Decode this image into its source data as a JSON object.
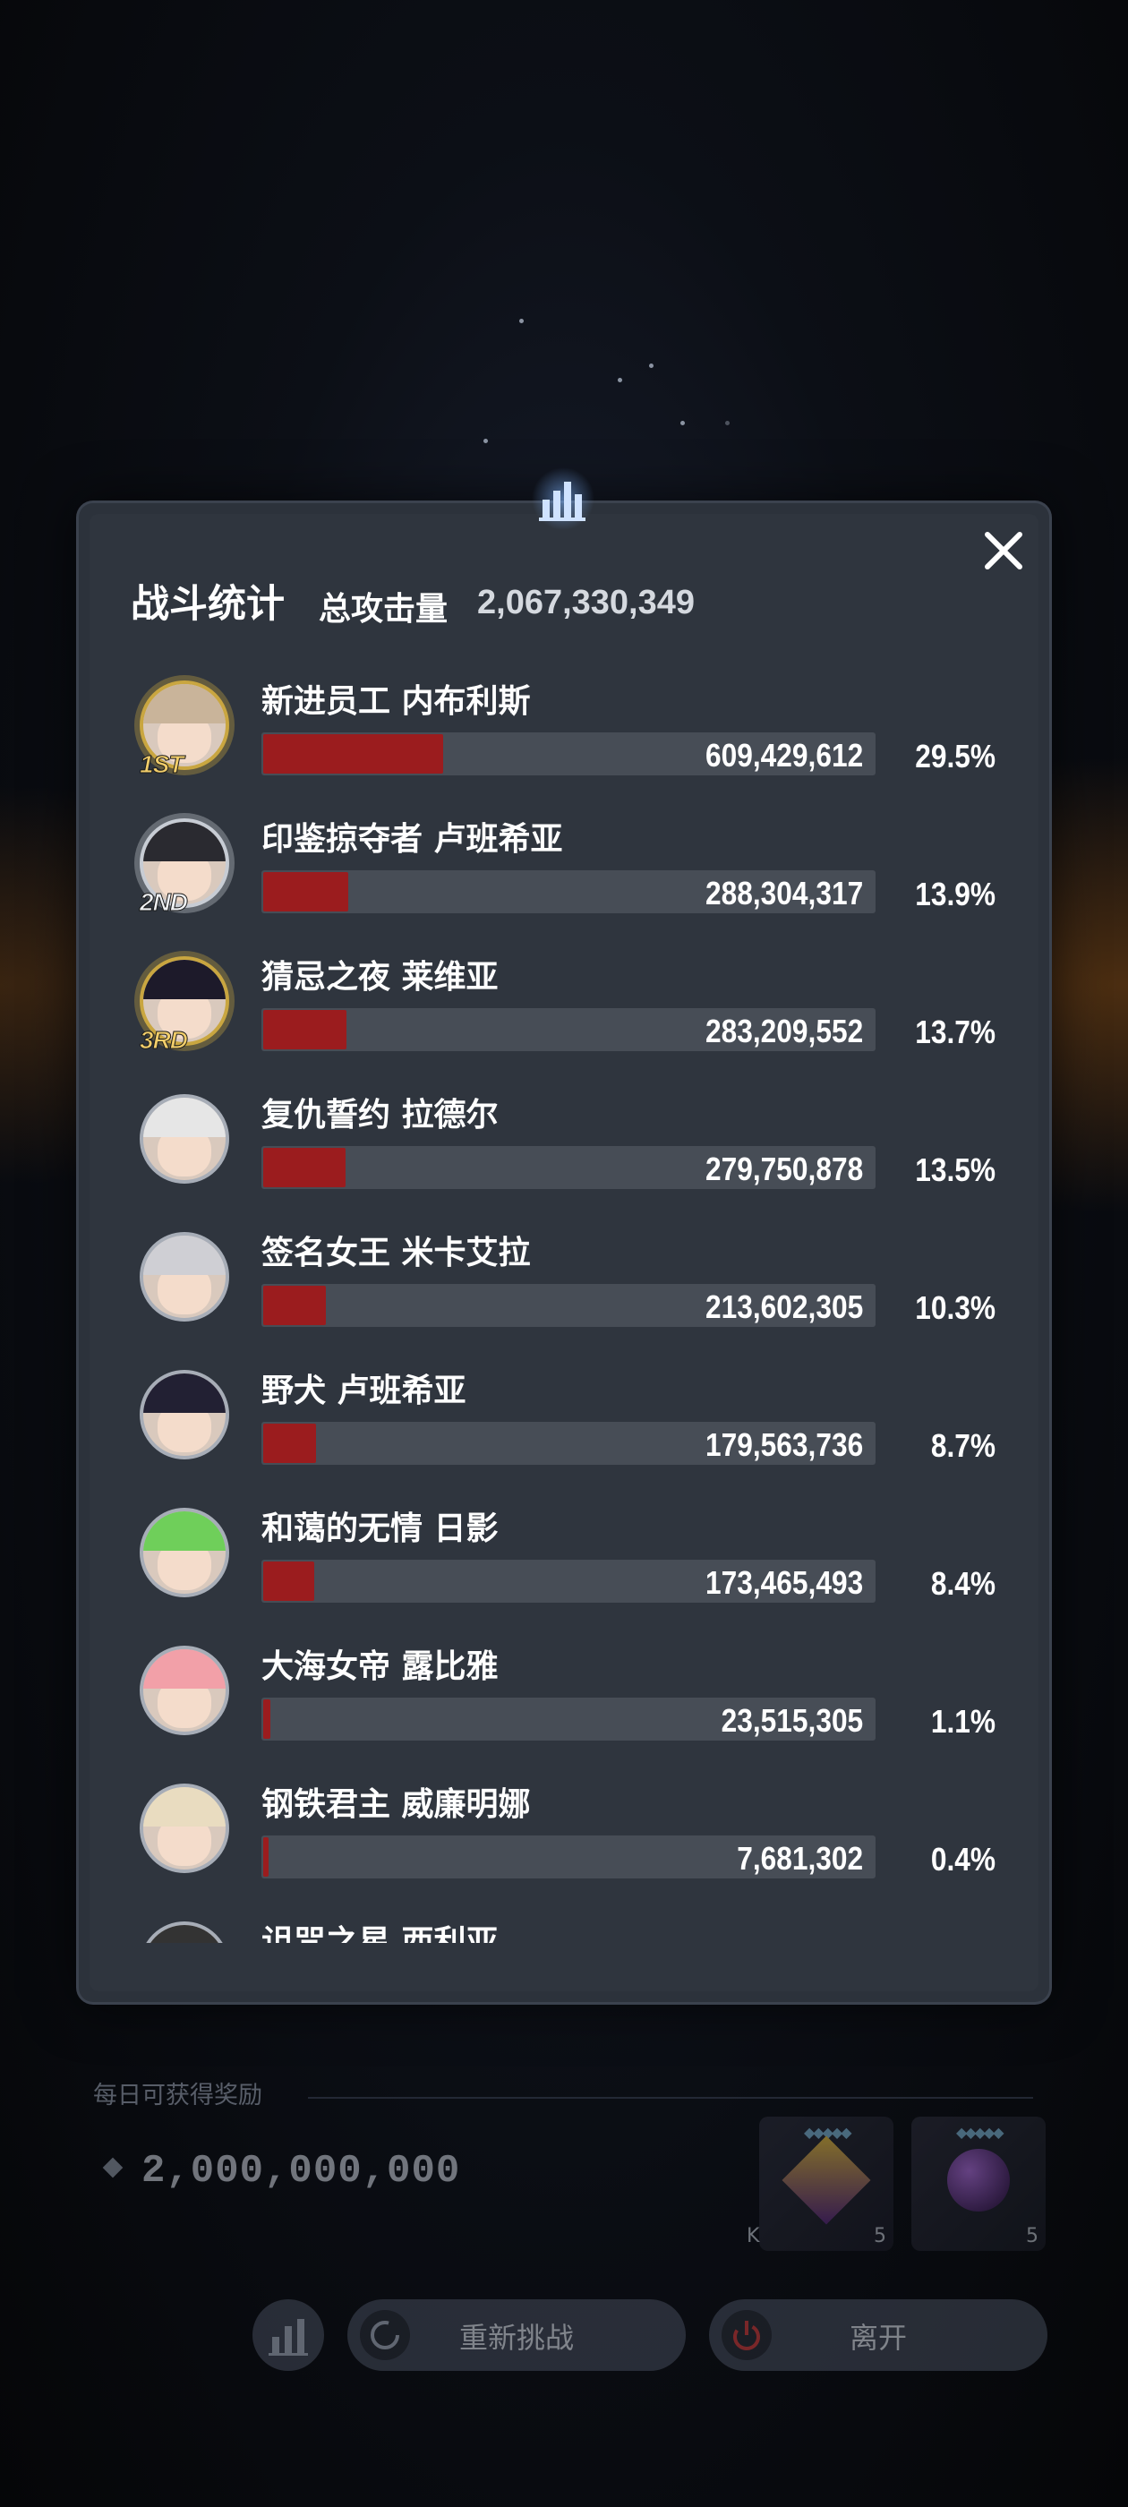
{
  "modal": {
    "title": "战斗统计",
    "total_label": "总攻击量",
    "total_value": "2,067,330,349",
    "rows": [
      {
        "name": "新进员工 内布利斯",
        "value": "609,429,612",
        "percent": "29.5%",
        "share": 0.295,
        "rank": "1ST"
      },
      {
        "name": "印鉴掠夺者 卢班希亚",
        "value": "288,304,317",
        "percent": "13.9%",
        "share": 0.139,
        "rank": "2ND"
      },
      {
        "name": "猜忌之夜 莱维亚",
        "value": "283,209,552",
        "percent": "13.7%",
        "share": 0.137,
        "rank": "3RD"
      },
      {
        "name": "复仇誓约 拉德尔",
        "value": "279,750,878",
        "percent": "13.5%",
        "share": 0.135,
        "rank": ""
      },
      {
        "name": "签名女王 米卡艾拉",
        "value": "213,602,305",
        "percent": "10.3%",
        "share": 0.103,
        "rank": ""
      },
      {
        "name": "野犬 卢班希亚",
        "value": "179,563,736",
        "percent": "8.7%",
        "share": 0.087,
        "rank": ""
      },
      {
        "name": "和蔼的无情 日影",
        "value": "173,465,493",
        "percent": "8.4%",
        "share": 0.084,
        "rank": ""
      },
      {
        "name": "大海女帝 露比雅",
        "value": "23,515,305",
        "percent": "1.1%",
        "share": 0.011,
        "rank": ""
      },
      {
        "name": "钢铁君主 威廉明娜",
        "value": "7,681,302",
        "percent": "0.4%",
        "share": 0.004,
        "rank": ""
      },
      {
        "name": "诅咒之星 西利亚",
        "value": "",
        "percent": "",
        "share": 0,
        "rank": ""
      }
    ]
  },
  "background": {
    "reward_label": "每日可获得奖励",
    "reward_value": "2,000,000,000",
    "items": [
      {
        "count": "5",
        "prefix": "K"
      },
      {
        "count": "5",
        "prefix": ""
      }
    ],
    "retry_label": "重新挑战",
    "leave_label": "离开"
  },
  "icons": [
    "bar-chart-icon",
    "close-icon",
    "refresh-icon",
    "power-icon",
    "diamond-icon"
  ],
  "colors": {
    "bar_fill": "#9b1c1e",
    "bar_track": "#474d56",
    "panel": "#2f353e",
    "gold": "#f1cd6a"
  }
}
